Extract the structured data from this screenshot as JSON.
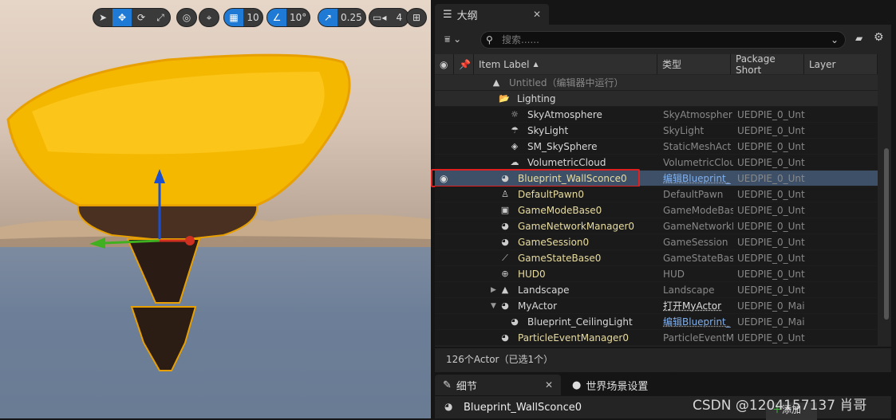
{
  "viewport": {
    "toolbar": {
      "select": "select-icon",
      "translate": "translate-icon",
      "rotate": "rotate-icon",
      "scale": "scale-icon",
      "grid_snap": "10",
      "rot_snap": "10°",
      "scale_snap": "0.25",
      "camera_speed": "4"
    }
  },
  "outliner": {
    "tab_title": "大纲",
    "search_placeholder": "搜索......",
    "columns": [
      "Item Label",
      "类型",
      "Package Short",
      "Layer"
    ],
    "rows": [
      {
        "label": "Untitled（编辑器中运行）",
        "type": "",
        "pkg": ""
      },
      {
        "label": "Lighting",
        "type": "",
        "pkg": ""
      },
      {
        "label": "SkyAtmosphere",
        "type": "SkyAtmospher",
        "pkg": "UEDPIE_0_Unt"
      },
      {
        "label": "SkyLight",
        "type": "SkyLight",
        "pkg": "UEDPIE_0_Unt"
      },
      {
        "label": "SM_SkySphere",
        "type": "StaticMeshAct",
        "pkg": "UEDPIE_0_Unt"
      },
      {
        "label": "VolumetricCloud",
        "type": "VolumetricClou",
        "pkg": "UEDPIE_0_Unt"
      },
      {
        "label": "Blueprint_WallSconce0",
        "type": "编辑Blueprint_",
        "pkg": "UEDPIE_0_Unt"
      },
      {
        "label": "DefaultPawn0",
        "type": "DefaultPawn",
        "pkg": "UEDPIE_0_Unt"
      },
      {
        "label": "GameModeBase0",
        "type": "GameModeBas",
        "pkg": "UEDPIE_0_Unt"
      },
      {
        "label": "GameNetworkManager0",
        "type": "GameNetworkI",
        "pkg": "UEDPIE_0_Unt"
      },
      {
        "label": "GameSession0",
        "type": "GameSession",
        "pkg": "UEDPIE_0_Unt"
      },
      {
        "label": "GameStateBase0",
        "type": "GameStateBas",
        "pkg": "UEDPIE_0_Unt"
      },
      {
        "label": "HUD0",
        "type": "HUD",
        "pkg": "UEDPIE_0_Unt"
      },
      {
        "label": "Landscape",
        "type": "Landscape",
        "pkg": "UEDPIE_0_Unt"
      },
      {
        "label": "MyActor",
        "type": "打开MyActor",
        "pkg": "UEDPIE_0_Mai"
      },
      {
        "label": "Blueprint_CeilingLight",
        "type": "编辑Blueprint_",
        "pkg": "UEDPIE_0_Mai"
      },
      {
        "label": "ParticleEventManager0",
        "type": "ParticleEventM",
        "pkg": "UEDPIE_0_Unt"
      }
    ],
    "footer": "126个Actor（已选1个）"
  },
  "details": {
    "tab_title": "细节",
    "world_tab": "世界场景设置",
    "actor_name": "Blueprint_WallSconce0",
    "add_label": "添加"
  },
  "watermark": "CSDN @1204157137 肖哥",
  "colors": {
    "selection": "#3d5068",
    "highlight_box": "#e02020",
    "actor_yellow": "#e8dca0",
    "accent": "#1f7ad6"
  }
}
